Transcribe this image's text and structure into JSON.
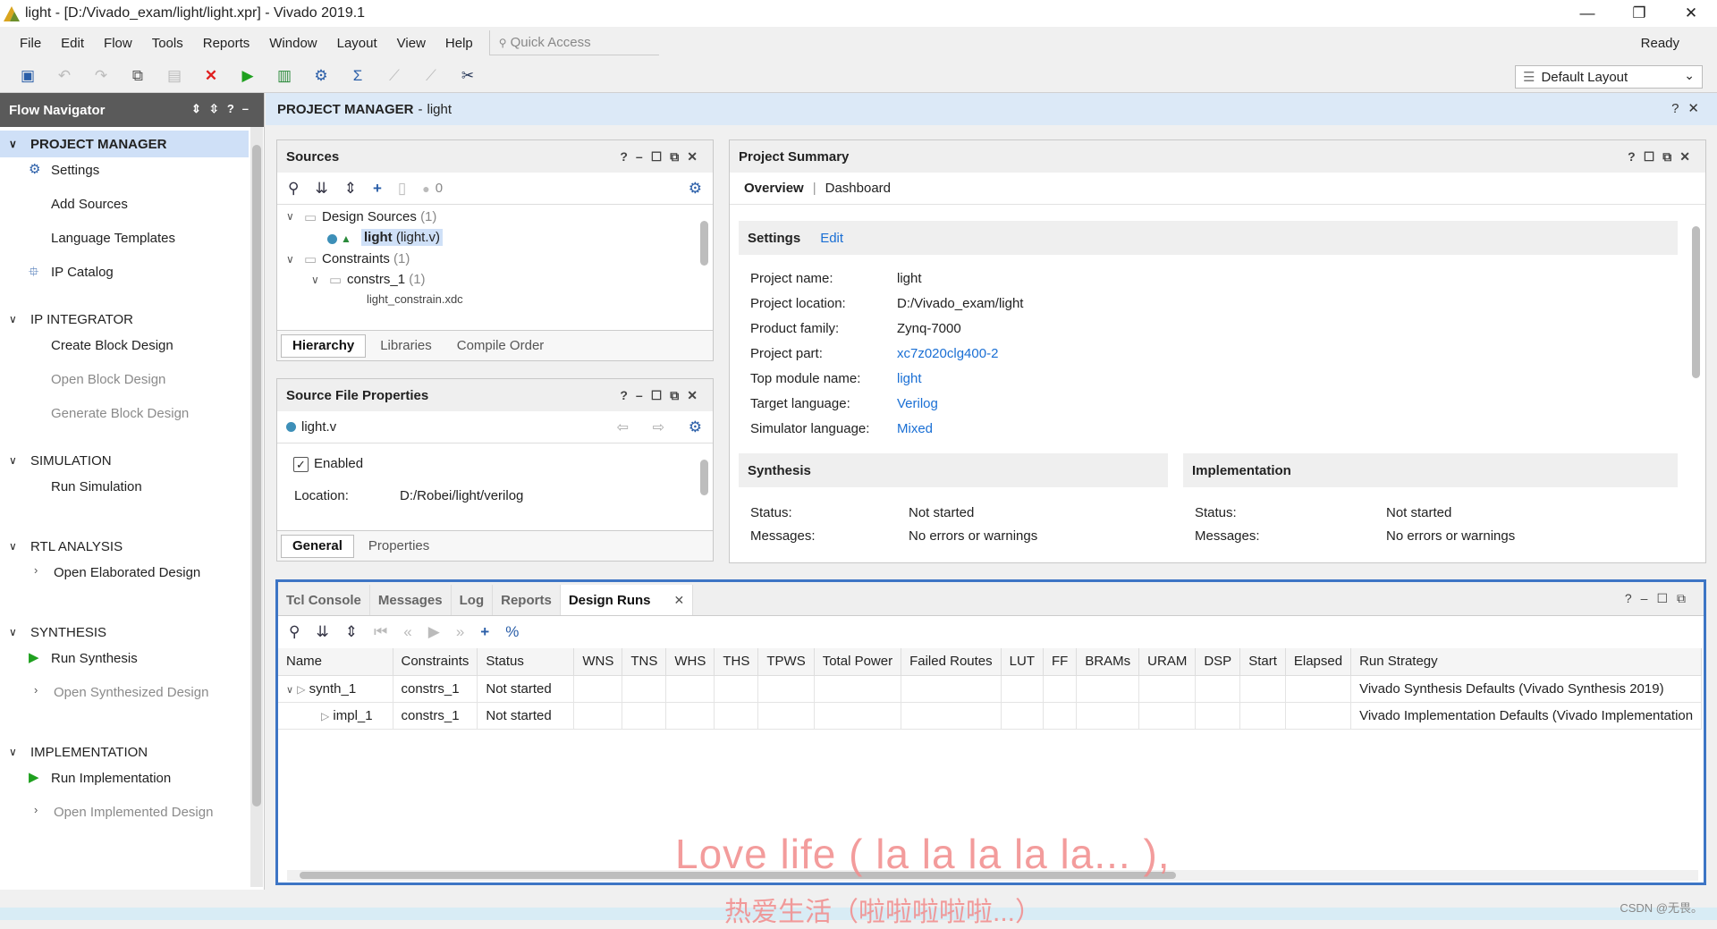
{
  "window": {
    "title": "light - [D:/Vivado_exam/light/light.xpr] - Vivado 2019.1",
    "minimize": "—",
    "restore": "❐",
    "close": "✕"
  },
  "menu": [
    "File",
    "Edit",
    "Flow",
    "Tools",
    "Reports",
    "Window",
    "Layout",
    "View",
    "Help"
  ],
  "quick_access": {
    "placeholder": "Quick Access"
  },
  "status": "Ready",
  "layout_select": {
    "value": "Default Layout"
  },
  "toolbar_icons": [
    "open-project-icon",
    "undo-icon",
    "redo-icon",
    "copy-icon",
    "paste-icon",
    "delete-icon",
    "run-icon",
    "program-device-icon",
    "settings-icon",
    "sigma-icon",
    "waveform-icon",
    "debug-icon",
    "tools-icon"
  ],
  "flow_navigator": {
    "title": "Flow Navigator",
    "sections": [
      {
        "label": "PROJECT MANAGER",
        "items": [
          "Settings",
          "Add Sources",
          "Language Templates",
          "IP Catalog"
        ]
      },
      {
        "label": "IP INTEGRATOR",
        "items": [
          "Create Block Design",
          "Open Block Design",
          "Generate Block Design"
        ]
      },
      {
        "label": "SIMULATION",
        "items": [
          "Run Simulation"
        ]
      },
      {
        "label": "RTL ANALYSIS",
        "items": [
          "Open Elaborated Design"
        ]
      },
      {
        "label": "SYNTHESIS",
        "items": [
          "Run Synthesis",
          "Open Synthesized Design"
        ]
      },
      {
        "label": "IMPLEMENTATION",
        "items": [
          "Run Implementation",
          "Open Implemented Design"
        ]
      }
    ]
  },
  "header": {
    "title": "PROJECT MANAGER",
    "sep": "-",
    "project": "light"
  },
  "sources": {
    "title": "Sources",
    "count": "0",
    "tree": {
      "design_sources": "Design Sources",
      "design_sources_count": "(1)",
      "top": "light",
      "top_file": "(light.v)",
      "constraints": "Constraints",
      "constraints_count": "(1)",
      "constrs": "constrs_1",
      "constrs_count": "(1)",
      "xdc": "light_constrain.xdc"
    },
    "tabs": [
      "Hierarchy",
      "Libraries",
      "Compile Order"
    ]
  },
  "source_props": {
    "title": "Source File Properties",
    "file": "light.v",
    "enabled_label": "Enabled",
    "location_label": "Location:",
    "location_value": "D:/Robei/light/verilog",
    "tabs": [
      "General",
      "Properties"
    ]
  },
  "summary": {
    "title": "Project Summary",
    "tabs": [
      "Overview",
      "Dashboard"
    ],
    "settings_title": "Settings",
    "edit": "Edit",
    "fields": [
      {
        "k": "Project name:",
        "v": "light"
      },
      {
        "k": "Project location:",
        "v": "D:/Vivado_exam/light"
      },
      {
        "k": "Product family:",
        "v": "Zynq-7000"
      },
      {
        "k": "Project part:",
        "v": "xc7z020clg400-2"
      },
      {
        "k": "Top module name:",
        "v": "light"
      },
      {
        "k": "Target language:",
        "v": "Verilog"
      },
      {
        "k": "Simulator language:",
        "v": "Mixed"
      }
    ],
    "synthesis": {
      "title": "Synthesis",
      "status_label": "Status:",
      "status": "Not started",
      "messages_label": "Messages:",
      "messages": "No errors or warnings"
    },
    "implementation": {
      "title": "Implementation",
      "status_label": "Status:",
      "status": "Not started",
      "messages_label": "Messages:",
      "messages": "No errors or warnings"
    }
  },
  "bottom": {
    "tabs": [
      "Tcl Console",
      "Messages",
      "Log",
      "Reports",
      "Design Runs"
    ],
    "columns": [
      "Name",
      "Constraints",
      "Status",
      "WNS",
      "TNS",
      "WHS",
      "THS",
      "TPWS",
      "Total Power",
      "Failed Routes",
      "LUT",
      "FF",
      "BRAMs",
      "URAM",
      "DSP",
      "Start",
      "Elapsed",
      "Run Strategy"
    ],
    "rows": [
      {
        "name": "synth_1",
        "constraints": "constrs_1",
        "status": "Not started",
        "strategy": "Vivado Synthesis Defaults (Vivado Synthesis 2019)"
      },
      {
        "name": "impl_1",
        "constraints": "constrs_1",
        "status": "Not started",
        "strategy": "Vivado Implementation Defaults (Vivado Implementation"
      }
    ]
  },
  "watermark": {
    "line1": "Love life ( la la la la la... ),",
    "line2": "热爱生活（啦啦啦啦啦...）",
    "csdn": "CSDN @无畏。"
  },
  "colors": {
    "accent": "#3d75c5",
    "link": "#1a6fd4",
    "header_bg": "#dce9f7",
    "selected_bg": "#cfe0f7"
  }
}
